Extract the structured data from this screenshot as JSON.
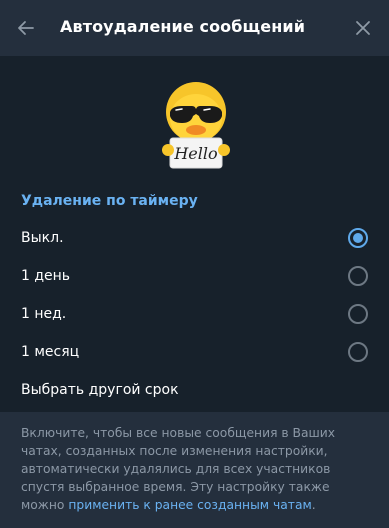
{
  "header": {
    "title": "Автоудаление сообщений",
    "back_icon": "arrow-left-icon",
    "close_icon": "close-icon"
  },
  "sticker": {
    "text": "Hello",
    "description_icon": "duck-with-sunglasses-sticker"
  },
  "section": {
    "title": "Удаление по таймеру"
  },
  "options": [
    {
      "label": "Выкл.",
      "checked": true
    },
    {
      "label": "1 день",
      "checked": false
    },
    {
      "label": "1 нед.",
      "checked": false
    },
    {
      "label": "1 месяц",
      "checked": false
    }
  ],
  "custom_option": {
    "label": "Выбрать другой срок"
  },
  "footer": {
    "text": "Включите, чтобы все новые сообщения в Ваших чатах, созданных после изменения настройки, автоматически удалялись для всех участников спустя выбранное время. Эту настройку также можно ",
    "link": "применить к ранее созданным чатам",
    "tail": "."
  },
  "colors": {
    "header_bg": "#242f3d",
    "content_bg": "#17212b",
    "accent": "#5fa9ea",
    "section_title": "#6ab2f2",
    "muted_text": "#8c98a6"
  }
}
